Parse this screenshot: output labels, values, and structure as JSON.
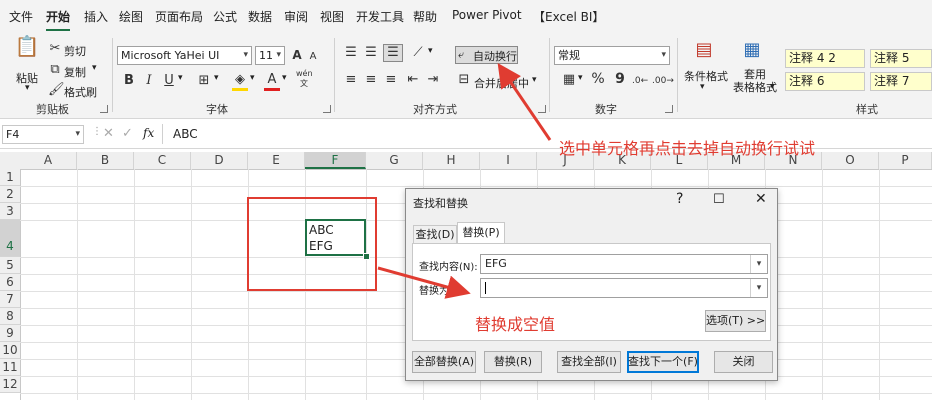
{
  "menu": {
    "items": [
      "文件",
      "开始",
      "插入",
      "绘图",
      "页面布局",
      "公式",
      "数据",
      "审阅",
      "视图",
      "开发工具",
      "帮助",
      "Power Pivot",
      "【Excel BI】"
    ],
    "active": "开始"
  },
  "ribbon": {
    "clipboard": {
      "paste": "粘贴",
      "cut": "剪切",
      "copy": "复制",
      "format_painter": "格式刷",
      "label": "剪贴板"
    },
    "font": {
      "name": "Microsoft YaHei UI",
      "size": "11",
      "bold": "B",
      "italic": "I",
      "underline": "U",
      "grow": "A",
      "shrink": "A",
      "wen": "wén",
      "label": "字体"
    },
    "alignment": {
      "wrap_text": "自动换行",
      "merge_center": "合并后居中",
      "label": "对齐方式"
    },
    "number": {
      "format": "常规",
      "percent": "%",
      "comma": "9",
      "label": "数字"
    },
    "styles": {
      "conditional": "条件格式",
      "table": "套用\n表格格式",
      "style_boxes": [
        "注释 4 2",
        "注释 5",
        "注释 6",
        "注释 7"
      ],
      "label": "样式"
    }
  },
  "formula_bar": {
    "name_box": "F4",
    "fx": "fx",
    "value": "ABC"
  },
  "grid": {
    "columns": [
      "A",
      "B",
      "C",
      "D",
      "E",
      "F",
      "G",
      "H",
      "I",
      "J",
      "K",
      "L",
      "M",
      "N",
      "O",
      "P"
    ],
    "rows": [
      "1",
      "2",
      "3",
      "4",
      "5",
      "6",
      "7",
      "8",
      "9",
      "10",
      "11",
      "12"
    ],
    "selected_column": "F",
    "selected_row": "4",
    "cell_f4_lines": [
      "ABC",
      "EFG"
    ]
  },
  "dialog": {
    "title": "查找和替换",
    "tabs": [
      "查找(D)",
      "替换(P)"
    ],
    "active_tab": "替换(P)",
    "find_label": "查找内容(N):",
    "find_value": "EFG",
    "replace_label": "替换为(E):",
    "replace_value": "",
    "options_button": "选项(T) >>",
    "buttons": [
      "全部替换(A)",
      "替换(R)",
      "查找全部(I)",
      "查找下一个(F)",
      "关闭"
    ],
    "default_button": "查找下一个(F)"
  },
  "annotations": {
    "wrap_hint": "选中单元格再点击去掉自动换行试试",
    "replace_hint": "替换成空值"
  },
  "colors": {
    "accent": "#1e7145",
    "annotation_red": "#e03c31",
    "style_yellow": "#ffffcc",
    "dialog_blue": "#0078d7"
  }
}
